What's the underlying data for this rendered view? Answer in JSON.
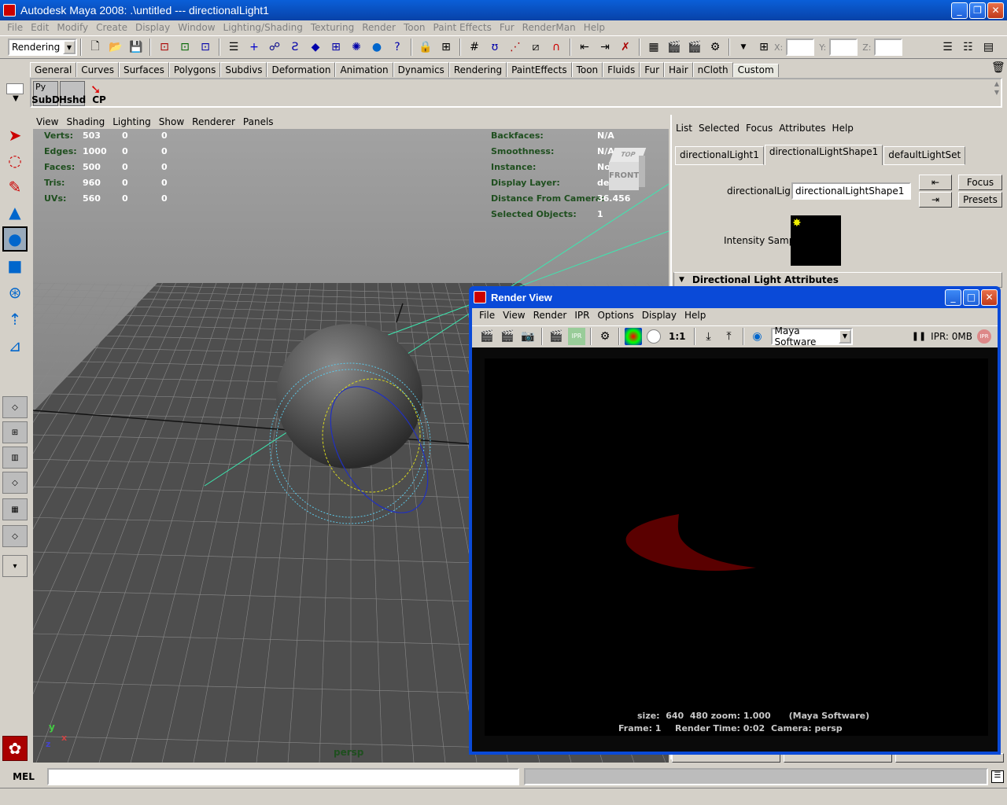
{
  "window": {
    "title": "Autodesk Maya 2008: .\\untitled   ---   directionalLight1"
  },
  "menubar": [
    "File",
    "Edit",
    "Modify",
    "Create",
    "Display",
    "Window",
    "Lighting/Shading",
    "Texturing",
    "Render",
    "Toon",
    "Paint Effects",
    "Fur",
    "RenderMan",
    "Help"
  ],
  "statusline": {
    "menuset": "Rendering",
    "x_label": "X:",
    "y_label": "Y:",
    "z_label": "Z:"
  },
  "shelf": {
    "tabs": [
      "General",
      "Curves",
      "Surfaces",
      "Polygons",
      "Subdivs",
      "Deformation",
      "Animation",
      "Dynamics",
      "Rendering",
      "PaintEffects",
      "Toon",
      "Fluids",
      "Fur",
      "Hair",
      "nCloth",
      "Custom"
    ],
    "active_tab": "Custom",
    "buttons": [
      "SubD",
      "Hshd",
      "CP"
    ],
    "py_label": "Py"
  },
  "viewport": {
    "menu": [
      "View",
      "Shading",
      "Lighting",
      "Show",
      "Renderer",
      "Panels"
    ],
    "hud_left": [
      {
        "label": "Verts:",
        "a": "503",
        "b": "0",
        "c": "0"
      },
      {
        "label": "Edges:",
        "a": "1000",
        "b": "0",
        "c": "0"
      },
      {
        "label": "Faces:",
        "a": "500",
        "b": "0",
        "c": "0"
      },
      {
        "label": "Tris:",
        "a": "960",
        "b": "0",
        "c": "0"
      },
      {
        "label": "UVs:",
        "a": "560",
        "b": "0",
        "c": "0"
      }
    ],
    "hud_right": [
      {
        "label": "Backfaces:",
        "value": "N/A"
      },
      {
        "label": "Smoothness:",
        "value": "N/A"
      },
      {
        "label": "Instance:",
        "value": "No"
      },
      {
        "label": "Display Layer:",
        "value": "default"
      },
      {
        "label": "Distance From Camera:",
        "value": "36.456"
      },
      {
        "label": "Selected Objects:",
        "value": "1"
      }
    ],
    "camera": "persp",
    "viewcube_top": "TOP",
    "viewcube_front": "FRONT",
    "axis_y": "y",
    "axis_x": "x",
    "axis_z": "z"
  },
  "attribute_editor": {
    "menu": [
      "List",
      "Selected",
      "Focus",
      "Attributes",
      "Help"
    ],
    "tabs": [
      "directionalLight1",
      "directionalLightShape1",
      "defaultLightSet"
    ],
    "active_tab": "directionalLightShape1",
    "node_label": "directionalLight:",
    "node_value": "directionalLightShape1",
    "focus_button": "Focus",
    "presets_button": "Presets",
    "intensity_label": "Intensity Sample",
    "section": "Directional Light Attributes"
  },
  "render_view": {
    "title": "Render View",
    "menu": [
      "File",
      "View",
      "Render",
      "IPR",
      "Options",
      "Display",
      "Help"
    ],
    "renderer": "Maya Software",
    "ratio": "1:1",
    "ipr_status": "IPR: 0MB",
    "info_line1": "size:  640  480 zoom: 1.000      (Maya Software)",
    "info_frame": "Frame: 1",
    "info_time": "Render Time: 0:02",
    "info_camera": "Camera: persp"
  },
  "command_line": {
    "label": "MEL"
  },
  "colors": {
    "titlebar": "#0842a8",
    "viewport_bg": "#5e5e5e",
    "hud_label": "#1f4f1f",
    "render_bg": "#000000",
    "render_shape": "#5a0000"
  }
}
